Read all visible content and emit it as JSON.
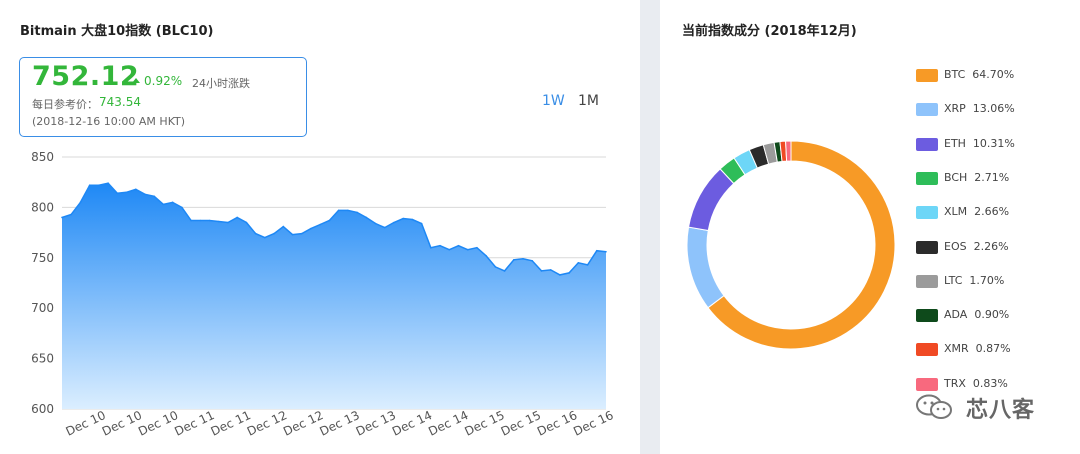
{
  "left": {
    "title": "Bitmain 大盘10指数 (BLC10)",
    "price": "752.12",
    "change_pct": "0.92%",
    "change_label": "24小时涨跌",
    "ref_label": "每日参考价：",
    "ref_value": "743.54",
    "timestamp": "(2018-12-16 10:00 AM HKT)",
    "ranges": [
      "1W",
      "1M"
    ],
    "active_range": "1W"
  },
  "right": {
    "title": "当前指数成分 (2018年12月)",
    "watermark": "芯八客"
  },
  "colors": {
    "accent": "#3a8ee6",
    "up": "#33b63a",
    "area_top": "#1e88f5",
    "area_bottom": "#dbeeff"
  },
  "chart_data": [
    {
      "type": "area",
      "title": "Bitmain 大盘10指数 (BLC10)",
      "ylim": [
        600,
        850
      ],
      "yticks": [
        600,
        650,
        700,
        750,
        800,
        850
      ],
      "xtick_labels": [
        "Dec 10",
        "Dec 10",
        "Dec 10",
        "Dec 11",
        "Dec 11",
        "Dec 12",
        "Dec 12",
        "Dec 13",
        "Dec 13",
        "Dec 14",
        "Dec 14",
        "Dec 15",
        "Dec 15",
        "Dec 16",
        "Dec 16"
      ],
      "grid": true,
      "values": [
        790,
        793,
        805,
        822,
        822,
        824,
        814,
        815,
        818,
        813,
        811,
        803,
        805,
        800,
        787,
        787,
        787,
        786,
        785,
        790,
        785,
        774,
        770,
        774,
        781,
        773,
        774,
        779,
        783,
        787,
        797,
        797,
        795,
        790,
        784,
        780,
        785,
        789,
        788,
        784,
        760,
        762,
        758,
        762,
        758,
        760,
        752,
        741,
        737,
        748,
        749,
        747,
        737,
        738,
        733,
        735,
        745,
        743,
        757,
        756
      ]
    },
    {
      "type": "pie",
      "title": "当前指数成分 (2018年12月)",
      "labels": [
        "BTC",
        "XRP",
        "ETH",
        "BCH",
        "XLM",
        "EOS",
        "LTC",
        "ADA",
        "XMR",
        "TRX"
      ],
      "values": [
        64.7,
        13.06,
        10.31,
        2.71,
        2.66,
        2.26,
        1.7,
        0.9,
        0.87,
        0.83
      ],
      "display": [
        "64.70%",
        "13.06%",
        "10.31%",
        "2.71%",
        "2.66%",
        "2.26%",
        "1.70%",
        "0.90%",
        "0.87%",
        "0.83%"
      ],
      "colors": [
        "#f79a26",
        "#8ec3fb",
        "#6c5ce0",
        "#2ebd59",
        "#6dd6f7",
        "#2b2b2b",
        "#9b9b9b",
        "#0e4a1b",
        "#f04a24",
        "#f8697e"
      ],
      "legend_position": "right"
    }
  ]
}
